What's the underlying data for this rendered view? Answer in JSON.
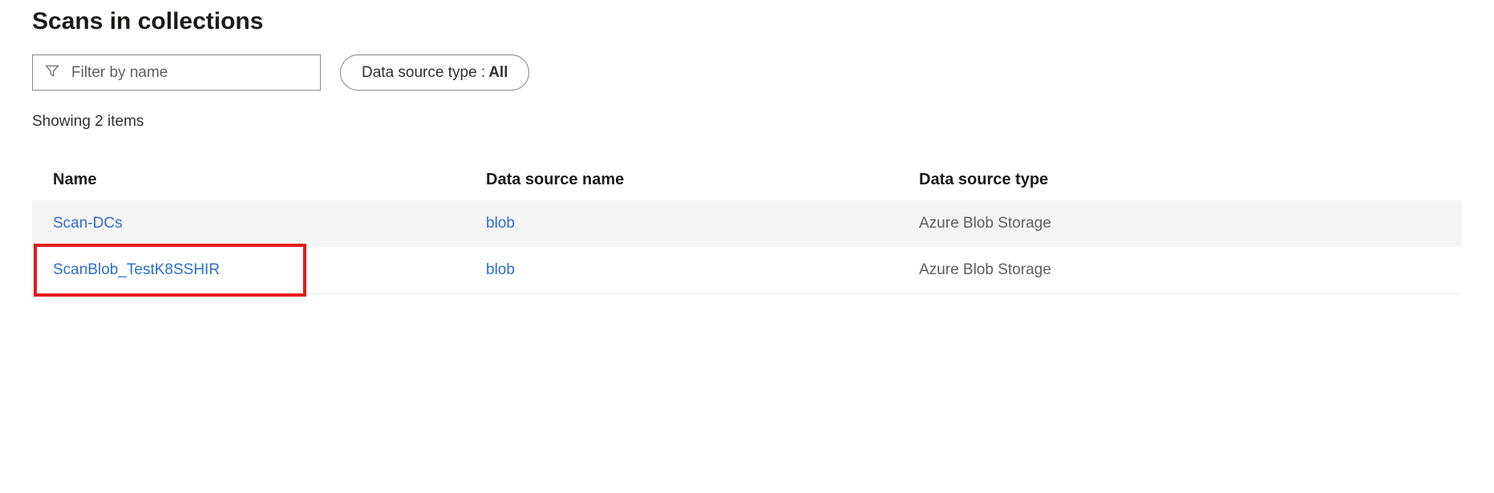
{
  "page": {
    "title": "Scans in collections"
  },
  "filter": {
    "placeholder": "Filter by name",
    "value": ""
  },
  "pill": {
    "label_prefix": "Data source type : ",
    "value": "All"
  },
  "status": {
    "text": "Showing 2 items"
  },
  "table": {
    "headers": {
      "name": "Name",
      "source": "Data source name",
      "type": "Data source type"
    },
    "rows": [
      {
        "name": "Scan-DCs",
        "source": "blob",
        "type": "Azure Blob Storage",
        "highlighted": false
      },
      {
        "name": "ScanBlob_TestK8SSHIR",
        "source": "blob",
        "type": "Azure Blob Storage",
        "highlighted": true
      }
    ]
  }
}
